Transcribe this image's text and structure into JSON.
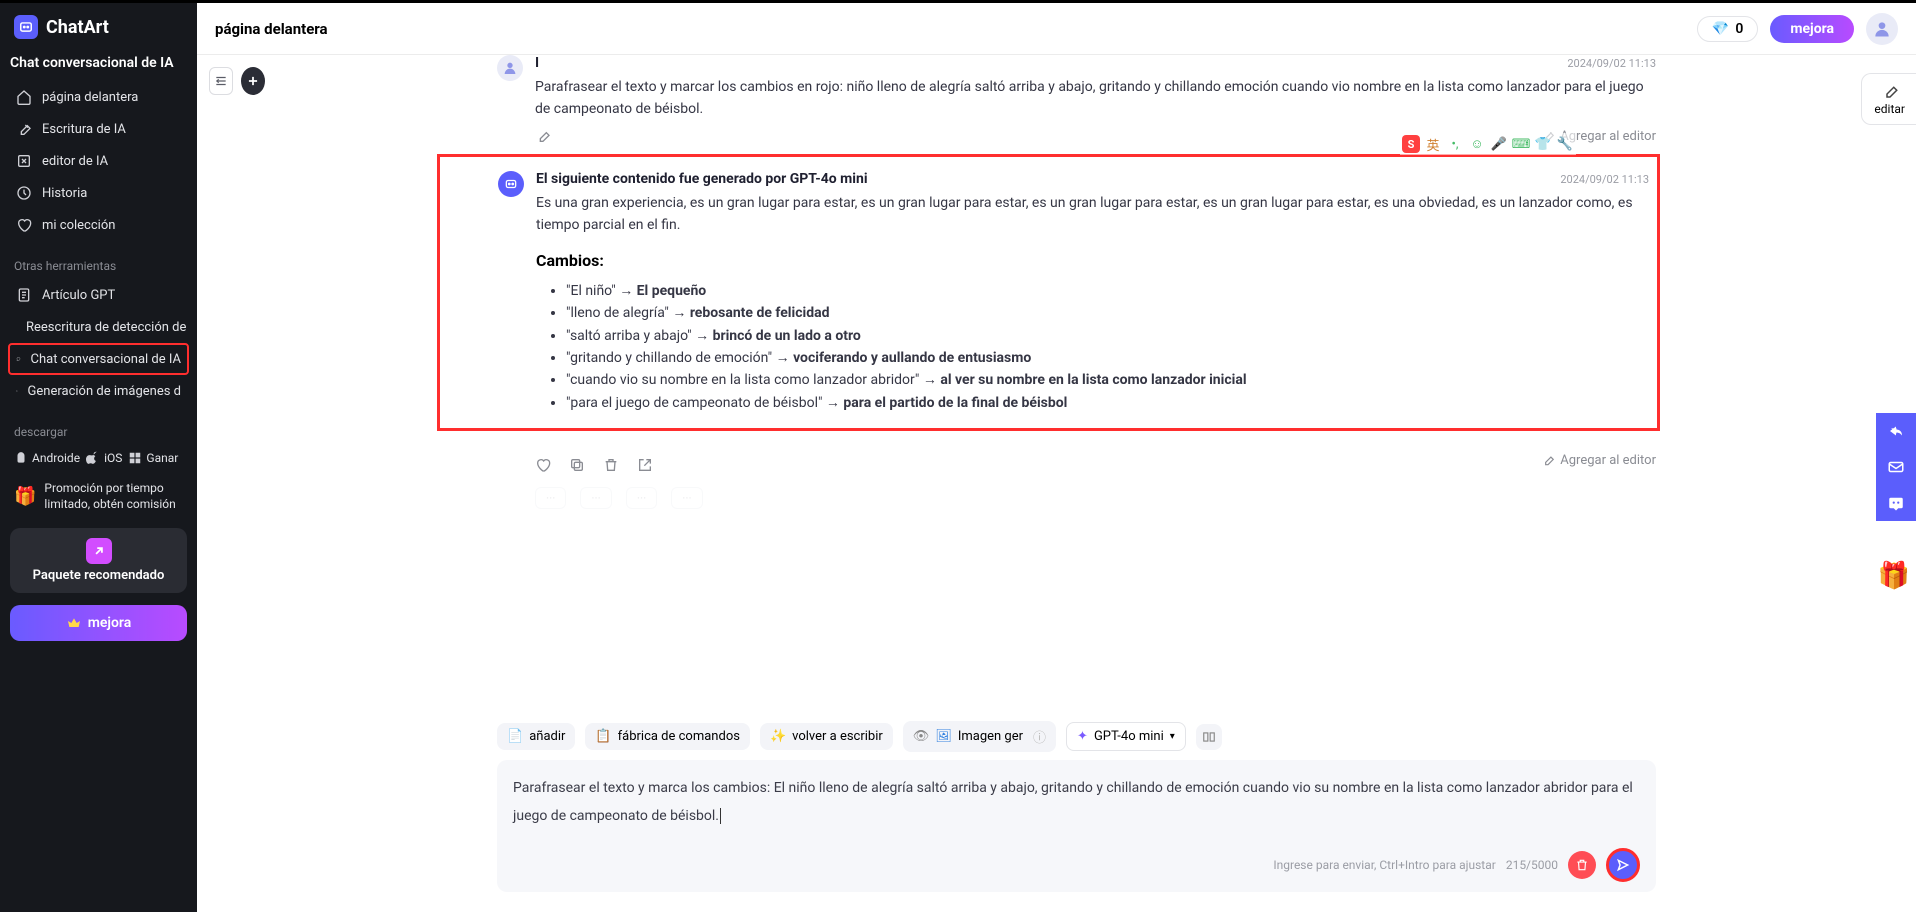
{
  "app": {
    "name": "ChatArt"
  },
  "sidebar": {
    "title": "Chat conversacional de IA",
    "nav": [
      {
        "label": "página delantera"
      },
      {
        "label": "Escritura de IA"
      },
      {
        "label": "editor de IA"
      },
      {
        "label": "Historia"
      },
      {
        "label": "mi colección"
      }
    ],
    "other_label": "Otras herramientas",
    "other": [
      {
        "label": "Artículo GPT"
      },
      {
        "label": "Reescritura de detección de"
      },
      {
        "label": "Chat conversacional de IA"
      },
      {
        "label": "Generación de imágenes d"
      }
    ],
    "download_label": "descargar",
    "downloads": [
      {
        "label": "Androide"
      },
      {
        "label": "iOS"
      },
      {
        "label": "Ganar"
      }
    ],
    "promo": "Promoción por tiempo limitado, obtén comisión",
    "recommended": "Paquete recomendado",
    "upgrade": "mejora"
  },
  "topbar": {
    "title": "página delantera",
    "diamond_count": "0",
    "mejora": "mejora"
  },
  "editar_label": "editar",
  "messages": {
    "user": {
      "name": "I",
      "time": "2024/09/02 11:13",
      "text": "Parafrasear el texto y marcar los cambios en rojo: niño lleno de alegría saltó arriba y abajo, gritando y chillando emoción cuando vio nombre en la lista como lanzador para el juego de campeonato de béisbol.",
      "add_editor": "Agregar al editor"
    },
    "ai": {
      "name": "El siguiente contenido fue generado por GPT-4o mini",
      "time": "2024/09/02 11:13",
      "text": "Es una gran experiencia, es un gran lugar para estar, es un gran lugar para estar, es un gran lugar para estar, es un gran lugar para estar, es una obviedad, es un lanzador como, es tiempo parcial en el fin.",
      "changes_header": "Cambios:",
      "changes": [
        {
          "from": "\"El niño\"",
          "to": "El pequeño"
        },
        {
          "from": "\"lleno de alegría\"",
          "to": "rebosante de felicidad"
        },
        {
          "from": "\"saltó arriba y abajo\"",
          "to": "brincó de un lado a otro"
        },
        {
          "from": "\"gritando y chillando de emoción\"",
          "to": "vociferando y aullando de entusiasmo"
        },
        {
          "from": "\"cuando vio su nombre en la lista como lanzador abridor\"",
          "to": "al ver su nombre en la lista como lanzador inicial"
        },
        {
          "from": "\"para el juego de campeonato de béisbol\"",
          "to": "para el partido de la final de béisbol"
        }
      ],
      "add_editor": "Agregar al editor"
    }
  },
  "chips": {
    "add": "añadir",
    "prompts": "fábrica de comandos",
    "rewrite": "volver a escribir",
    "image": "Imagen ger",
    "model": "GPT-4o mini"
  },
  "composer": {
    "text": "Parafrasear el texto y marca los cambios: El niño lleno de alegría saltó arriba y abajo, gritando y chillando de emoción cuando vio su nombre en la lista como lanzador abridor para el juego de campeonato de béisbol.",
    "hint": "Ingrese para enviar, Ctrl+Intro para ajustar",
    "count": "215/5000"
  }
}
